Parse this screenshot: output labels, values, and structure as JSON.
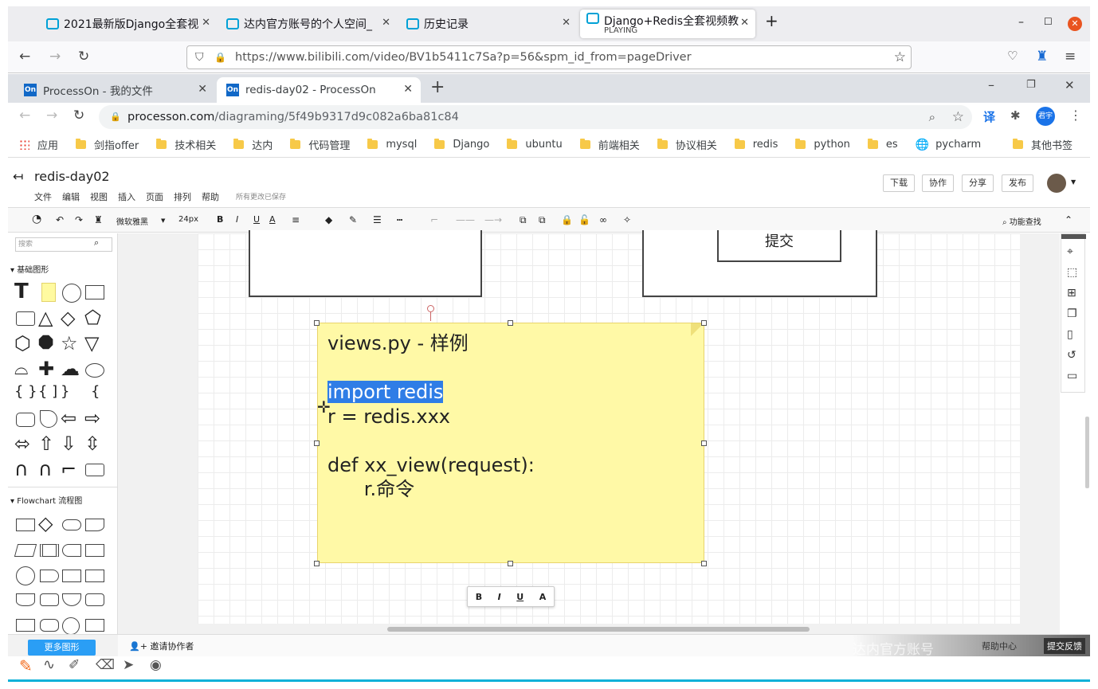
{
  "firefox": {
    "tabs": [
      {
        "title": "2021最新版Django全套视"
      },
      {
        "title": "达内官方账号的个人空间_"
      },
      {
        "title": "历史记录"
      },
      {
        "title": "Django+Redis全套视频教",
        "status": "PLAYING"
      }
    ],
    "url_host": "https://www.bilibili.com",
    "url_path": "/video/BV1b5411c7Sa?p=56&spm_id_from=pageDriver"
  },
  "chrome": {
    "tabs": [
      {
        "icon_text": "On",
        "title": "ProcessOn - 我的文件"
      },
      {
        "icon_text": "On",
        "title": "redis-day02 - ProcessOn"
      }
    ],
    "url_host": "processon.com",
    "url_path": "/diagraming/5f49b9317d9c082a6ba81c84",
    "avatar_text": "君宇",
    "translate_text": "译",
    "bookmarks": [
      "应用",
      "剑指offer",
      "技术相关",
      "达内",
      "代码管理",
      "mysql",
      "Django",
      "ubuntu",
      "前端相关",
      "协议相关",
      "redis",
      "python",
      "es",
      "pycharm"
    ],
    "other_bookmarks": "其他书签"
  },
  "processon": {
    "title": "redis-day02",
    "menu": [
      "文件",
      "编辑",
      "视图",
      "插入",
      "页面",
      "排列",
      "帮助"
    ],
    "save_status": "所有更改已保存",
    "buttons": {
      "download": "下载",
      "collab": "协作",
      "share": "分享",
      "publish": "发布"
    },
    "toolbar": {
      "font": "微软雅黑",
      "size": "24px",
      "bold": "B",
      "italic": "I",
      "underline": "U",
      "fontcolor": "A",
      "search": "功能查找"
    },
    "sidebar": {
      "search_placeholder": "搜索",
      "section_basic": "基础图形",
      "section_flow": "Flowchart 流程图",
      "more_shapes": "更多图形"
    },
    "canvas": {
      "submit_label": "提交",
      "note_lines": [
        "views.py - 样例",
        "",
        "import redis",
        "r = redis.xxx",
        "",
        "def xx_view(request):",
        "      r.命令"
      ],
      "minitool": [
        "B",
        "I",
        "U",
        "A"
      ]
    },
    "bottom": {
      "invite": "邀请协作者",
      "help": "帮助中心",
      "feedback": "提交反馈"
    },
    "watermark": "达内官方账号"
  }
}
